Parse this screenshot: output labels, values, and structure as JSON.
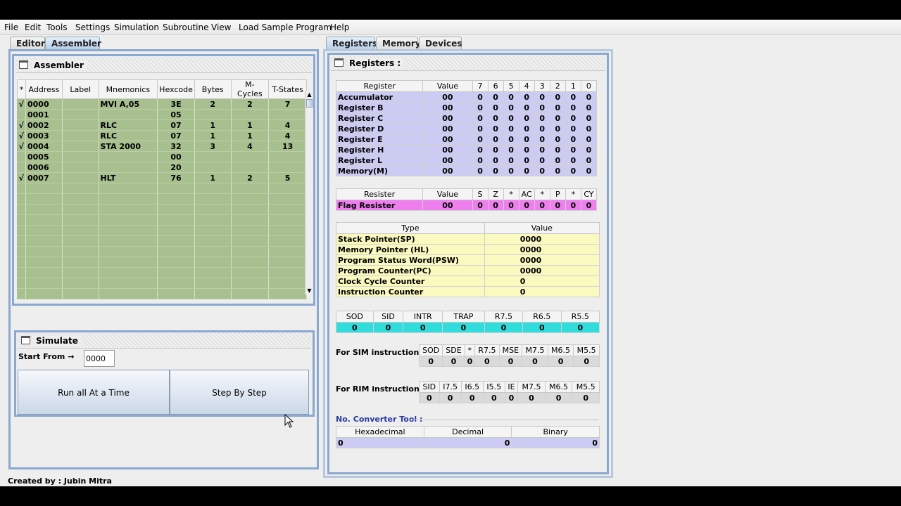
{
  "menu": [
    "File",
    "Edit",
    "Tools",
    "Settings",
    "Simulation",
    "Subroutine",
    "View",
    "Load Sample Program",
    "Help"
  ],
  "left_tabs": [
    "Editor",
    "Assembler"
  ],
  "right_tabs": [
    "Registers",
    "Memory",
    "Devices"
  ],
  "assembler": {
    "title": "Assembler",
    "columns": [
      "*",
      "Address",
      "Label",
      "Mnemonics",
      "Hexcode",
      "Bytes",
      "M-Cycles",
      "T-States"
    ],
    "rows": [
      [
        "√",
        "0000",
        "",
        "MVI A,05",
        "3E",
        "2",
        "2",
        "7"
      ],
      [
        "",
        "0001",
        "",
        "",
        "05",
        "",
        "",
        ""
      ],
      [
        "√",
        "0002",
        "",
        "RLC",
        "07",
        "1",
        "1",
        "4"
      ],
      [
        "√",
        "0003",
        "",
        "RLC",
        "07",
        "1",
        "1",
        "4"
      ],
      [
        "√",
        "0004",
        "",
        "STA 2000",
        "32",
        "3",
        "4",
        "13"
      ],
      [
        "",
        "0005",
        "",
        "",
        "00",
        "",
        "",
        ""
      ],
      [
        "",
        "0006",
        "",
        "",
        "20",
        "",
        "",
        ""
      ],
      [
        "√",
        "0007",
        "",
        "HLT",
        "76",
        "1",
        "2",
        "5"
      ]
    ]
  },
  "simulate": {
    "title": "Simulate",
    "start_from_label": "Start From →",
    "start_from_value": "0000",
    "run_all_label": "Run all At a Time",
    "step_label": "Step By Step"
  },
  "registers": {
    "title": "Registers :",
    "columns": [
      "Register",
      "Value",
      "7",
      "6",
      "5",
      "4",
      "3",
      "2",
      "1",
      "0"
    ],
    "rows": [
      [
        "Accumulator",
        "00",
        "0",
        "0",
        "0",
        "0",
        "0",
        "0",
        "0",
        "0"
      ],
      [
        "Register B",
        "00",
        "0",
        "0",
        "0",
        "0",
        "0",
        "0",
        "0",
        "0"
      ],
      [
        "Register C",
        "00",
        "0",
        "0",
        "0",
        "0",
        "0",
        "0",
        "0",
        "0"
      ],
      [
        "Register D",
        "00",
        "0",
        "0",
        "0",
        "0",
        "0",
        "0",
        "0",
        "0"
      ],
      [
        "Register E",
        "00",
        "0",
        "0",
        "0",
        "0",
        "0",
        "0",
        "0",
        "0"
      ],
      [
        "Register H",
        "00",
        "0",
        "0",
        "0",
        "0",
        "0",
        "0",
        "0",
        "0"
      ],
      [
        "Register L",
        "00",
        "0",
        "0",
        "0",
        "0",
        "0",
        "0",
        "0",
        "0"
      ],
      [
        "Memory(M)",
        "00",
        "0",
        "0",
        "0",
        "0",
        "0",
        "0",
        "0",
        "0"
      ]
    ]
  },
  "flags": {
    "columns": [
      "Resister",
      "Value",
      "S",
      "Z",
      "*",
      "AC",
      "*",
      "P",
      "*",
      "CY"
    ],
    "row": [
      "Flag Resister",
      "00",
      "0",
      "0",
      "0",
      "0",
      "0",
      "0",
      "0",
      "0"
    ]
  },
  "special": {
    "columns": [
      "Type",
      "Value"
    ],
    "rows": [
      [
        "Stack Pointer(SP)",
        "0000"
      ],
      [
        "Memory Pointer (HL)",
        "0000"
      ],
      [
        "Program Status Word(PSW)",
        "0000"
      ],
      [
        "Program Counter(PC)",
        "0000"
      ],
      [
        "Clock Cycle Counter",
        "0"
      ],
      [
        "Instruction Counter",
        "0"
      ]
    ]
  },
  "interrupts": {
    "columns": [
      "SOD",
      "SID",
      "INTR",
      "TRAP",
      "R7.5",
      "R6.5",
      "R5.5"
    ],
    "values": [
      "0",
      "0",
      "0",
      "0",
      "0",
      "0",
      "0"
    ]
  },
  "sim_instr": {
    "label": "For SIM instruction",
    "columns": [
      "SOD",
      "SDE",
      "*",
      "R7.5",
      "MSE",
      "M7.5",
      "M6.5",
      "M5.5"
    ],
    "values": [
      "0",
      "0",
      "0",
      "0",
      "0",
      "0",
      "0",
      "0"
    ]
  },
  "rim_instr": {
    "label": "For RIM instruction",
    "columns": [
      "SID",
      "I7.5",
      "I6.5",
      "I5.5",
      "IE",
      "M7.5",
      "M6.5",
      "M5.5"
    ],
    "values": [
      "0",
      "0",
      "0",
      "0",
      "0",
      "0",
      "0",
      "0"
    ]
  },
  "converter": {
    "label": "No. Converter Tool :",
    "columns": [
      "Hexadecimal",
      "Decimal",
      "Binary"
    ],
    "values": [
      "0",
      "0",
      "0"
    ]
  },
  "status": "Created by : Jubin Mitra",
  "colors": {
    "assembler_bg": "#a8c090",
    "register_bg": "#cbcbf3",
    "flag_bg": "#ef7eef",
    "special_bg": "#fafac0",
    "interrupt_bg": "#30dcdc",
    "frame_border": "#8aa8d0"
  }
}
